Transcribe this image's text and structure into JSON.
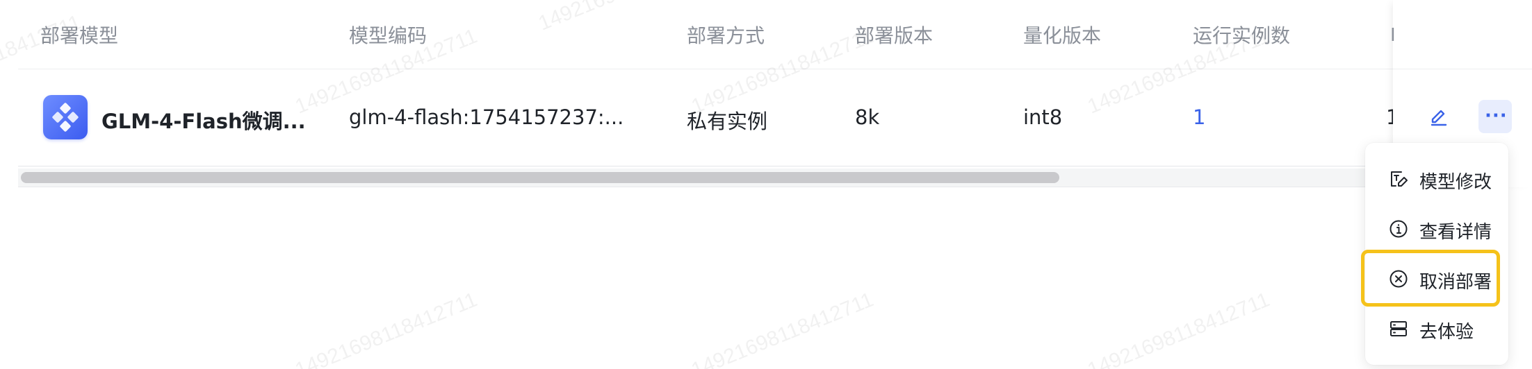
{
  "watermark": "14921698118412711",
  "table": {
    "columns": [
      "部署模型",
      "模型编码",
      "部署方式",
      "部署版本",
      "量化版本",
      "运行实例数"
    ],
    "fixed_column_header": "I",
    "rows": [
      {
        "model_name": "GLM-4-Flash微调...",
        "model_code": "glm-4-flash:1754157237:...",
        "deploy_method": "私有实例",
        "deploy_version": "8k",
        "quant_version": "int8",
        "instances": "1",
        "truncated_next": "1"
      }
    ]
  },
  "actions": {
    "edit_icon": "pencil-icon",
    "more_icon": "ellipsis-icon",
    "more_label": "···"
  },
  "menu": {
    "items": [
      {
        "label": "模型修改",
        "icon": "edit-text-icon"
      },
      {
        "label": "查看详情",
        "icon": "info-circle-icon"
      },
      {
        "label": "取消部署",
        "icon": "close-circle-icon"
      },
      {
        "label": "去体验",
        "icon": "server-icon"
      }
    ],
    "highlighted_index": 2,
    "highlight_color": "#f5c21a"
  },
  "colors": {
    "accent": "#3a62e8",
    "header_text": "#8b9099",
    "body_text": "#1f2329"
  }
}
